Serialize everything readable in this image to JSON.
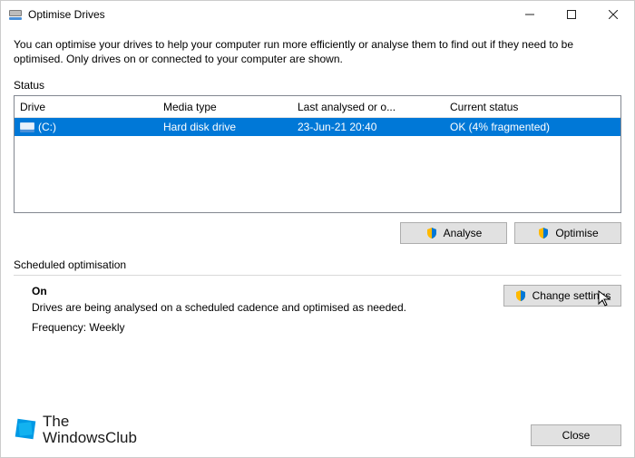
{
  "window": {
    "title": "Optimise Drives"
  },
  "intro": "You can optimise your drives to help your computer run more efficiently or analyse them to find out if they need to be optimised. Only drives on or connected to your computer are shown.",
  "status_label": "Status",
  "table": {
    "headers": {
      "drive": "Drive",
      "media": "Media type",
      "last": "Last analysed or o...",
      "status": "Current status"
    },
    "rows": [
      {
        "drive": "(C:)",
        "media": "Hard disk drive",
        "last": "23-Jun-21 20:40",
        "status": "OK (4% fragmented)",
        "selected": true
      }
    ]
  },
  "buttons": {
    "analyse": "Analyse",
    "optimise": "Optimise",
    "change_settings": "Change settings",
    "close": "Close"
  },
  "scheduled": {
    "label": "Scheduled optimisation",
    "on": "On",
    "desc": "Drives are being analysed on a scheduled cadence and optimised as needed.",
    "freq": "Frequency: Weekly"
  },
  "watermark": {
    "line1": "The",
    "line2": "WindowsClub"
  }
}
